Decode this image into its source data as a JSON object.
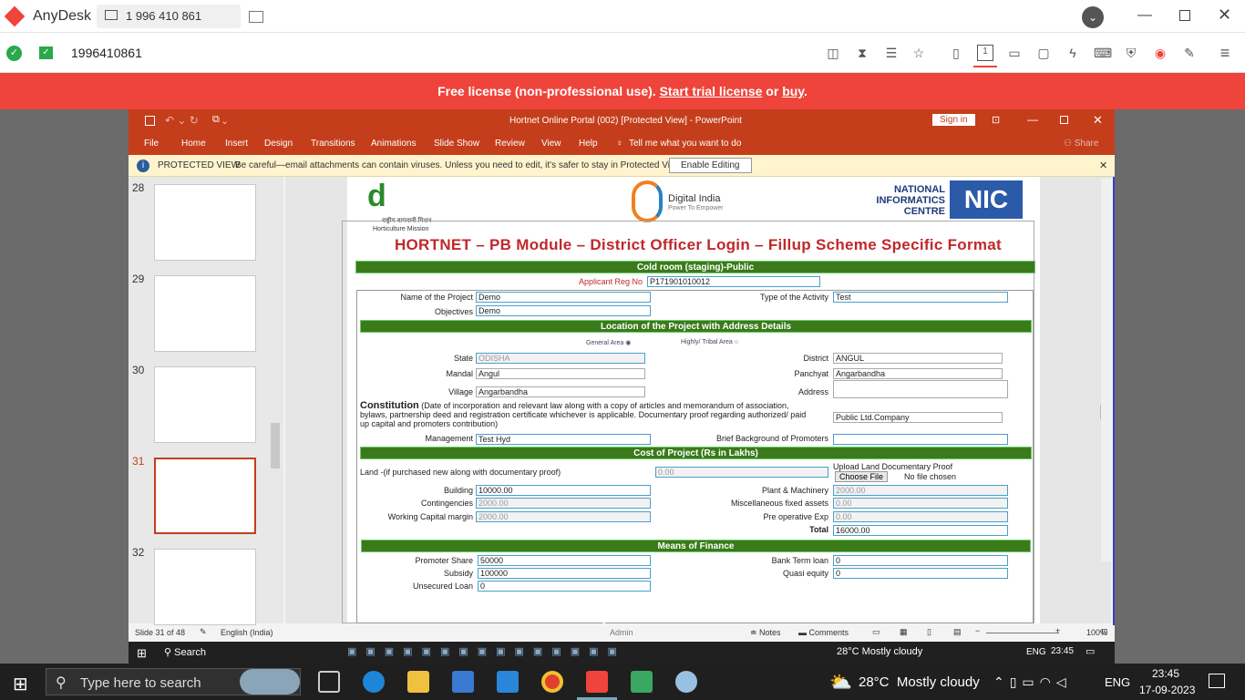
{
  "anydesk": {
    "app_name": "AnyDesk",
    "tab_id": "1 996 410 861",
    "address": "1996410861",
    "banner": {
      "text1": "Free license (non-professional use).",
      "link1": "Start trial license",
      "mid": " or ",
      "link2": "buy",
      "end": "."
    }
  },
  "ppt": {
    "title": "Hortnet Online Portal (002) [Protected View] - PowerPoint",
    "sign_in": "Sign in",
    "share": "Share",
    "menu": [
      "File",
      "Home",
      "Insert",
      "Design",
      "Transitions",
      "Animations",
      "Slide Show",
      "Review",
      "View",
      "Help"
    ],
    "tell_me": "Tell me what you want to do",
    "protected": {
      "label": "PROTECTED VIEW",
      "message": "Be careful—email attachments can contain viruses. Unless you need to edit, it's safer to stay in Protected View.",
      "button": "Enable Editing"
    },
    "thumbnails": [
      "28",
      "29",
      "30",
      "31",
      "32"
    ],
    "status": {
      "slide": "Slide 31 of 48",
      "language": "English (India)",
      "admin": "Admin",
      "notes": "Notes",
      "comments": "Comments",
      "zoom": "100%"
    }
  },
  "slide": {
    "heading": "HORTNET – PB Module – District Officer Login – Fillup Scheme Specific Format",
    "hm_label": "राष्ट्रीय बागवानी मिशन",
    "hm_sub": "Horticulture Mission",
    "digital_india": "Digital India",
    "digital_india_sub": "Power To Empower",
    "nic_text": "NATIONAL\nINFORMATICS\nCENTRE",
    "nic_logo": "NIC",
    "section1": "Cold room (staging)-Public",
    "applicant_label": "Applicant Reg No",
    "applicant_value": "P171901010012",
    "name_label": "Name of the Project",
    "name_value": "Demo",
    "activity_label": "Type of the Activity",
    "activity_value": "Test",
    "objectives_label": "Objectives",
    "objectives_value": "Demo",
    "location_bar": "Location of the Project with Address Details",
    "general_area": "General Area",
    "tribal_area": "Highly/ Tribal Area",
    "state_label": "State",
    "state_value": "ODISHA",
    "district_label": "District",
    "district_value": "ANGUL",
    "mandal_label": "Mandal",
    "mandal_value": "Angul",
    "panchyat_label": "Panchyat",
    "panchyat_value": "Angarbandha",
    "village_label": "Village",
    "village_value": "Angarbandha",
    "address_label": "Address",
    "constitution_title": "Constitution",
    "constitution_text": " (Date of incorporation and relevant law along with a copy of articles and memorandum of association, bylaws, partnership deed and registration certificate whichever is applicable. Documentary proof regarding authorized/ paid up capital and promoters contribution)",
    "constitution_value": "Public Ltd.Company",
    "management_label": "Management",
    "management_value": "Test Hyd",
    "promoters_label": "Brief Background of Promoters",
    "cost_bar": "Cost of Project (Rs in Lakhs)",
    "land_label": "Land -(if purchased new along with documentary proof)",
    "land_value": "0.00",
    "upload_label": "Upload Land Documentary Proof",
    "choose_file": "Choose File",
    "no_file": "No file chosen",
    "building_label": "Building",
    "building_value": "10000.00",
    "plant_label": "Plant & Machinery",
    "plant_value": "2000.00",
    "contingencies_label": "Contingencies",
    "contingencies_value": "2000.00",
    "misc_label": "Miscellaneous fixed assets",
    "misc_value": "0.00",
    "wcm_label": "Working Capital margin",
    "wcm_value": "2000.00",
    "preop_label": "Pre operative Exp",
    "preop_value": "0.00",
    "total_label": "Total",
    "total_value": "16000.00",
    "finance_bar": "Means of Finance",
    "promoter_label": "Promoter Share",
    "promoter_value": "50000",
    "bank_label": "Bank Term loan",
    "bank_value": "0",
    "subsidy_label": "Subsidy",
    "subsidy_value": "100000",
    "quasi_label": "Quasi equity",
    "quasi_value": "0",
    "unsecured_label": "Unsecured Loan",
    "unsecured_value": "0"
  },
  "remote_taskbar": {
    "search": "Search",
    "weather": "28°C  Mostly cloudy",
    "lang": "ENG",
    "time": "23:45"
  },
  "taskbar": {
    "search_placeholder": "Type here to search",
    "weather": "28°C  Mostly cloudy",
    "lang": "ENG",
    "time": "23:45",
    "date": "17-09-2023"
  },
  "colors": {
    "anydesk_red": "#ef443b",
    "ppt_orange": "#c43e1c",
    "form_green": "#3a7a1a"
  }
}
